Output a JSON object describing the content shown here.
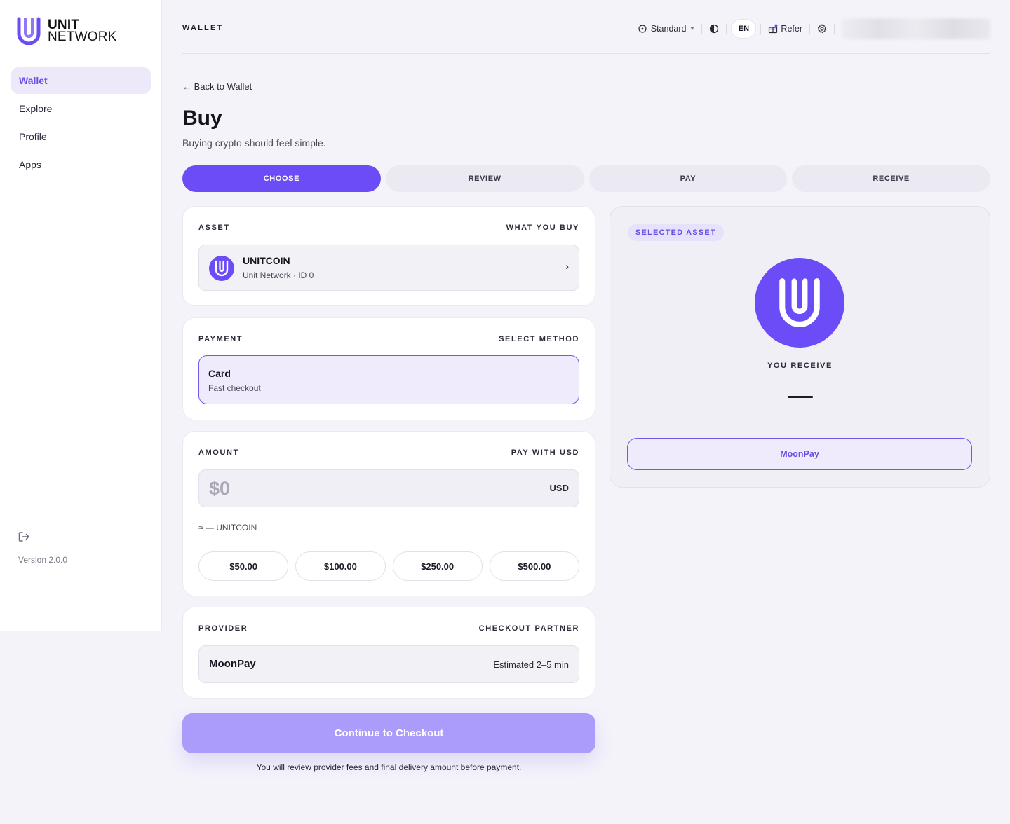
{
  "brand": {
    "line1": "UNIT",
    "line2": "NETWORK",
    "accent": "#6b4cf6"
  },
  "sidebar": {
    "items": [
      {
        "label": "Wallet",
        "active": true
      },
      {
        "label": "Explore"
      },
      {
        "label": "Profile"
      },
      {
        "label": "Apps"
      }
    ],
    "version": "Version 2.0.0",
    "logout_icon": "logout-icon"
  },
  "header": {
    "title": "WALLET",
    "mode": "Standard",
    "language": "EN",
    "refer": "Refer"
  },
  "page": {
    "back": "← Back to Wallet",
    "title": "Buy",
    "subtitle": "Buying crypto should feel simple."
  },
  "steps": [
    "CHOOSE",
    "REVIEW",
    "PAY",
    "RECEIVE"
  ],
  "asset": {
    "heading": "ASSET",
    "heading_right": "WHAT YOU BUY",
    "name": "UNITCOIN",
    "sub": "Unit Network · ID 0"
  },
  "payment": {
    "heading": "PAYMENT",
    "heading_right": "SELECT METHOD",
    "method": "Card",
    "method_sub": "Fast checkout"
  },
  "amount": {
    "heading": "AMOUNT",
    "heading_right": "PAY WITH USD",
    "placeholder": "$0",
    "currency": "USD",
    "approx": "≈ — UNITCOIN",
    "presets": [
      "$50.00",
      "$100.00",
      "$250.00",
      "$500.00"
    ]
  },
  "provider": {
    "heading": "PROVIDER",
    "heading_right": "CHECKOUT PARTNER",
    "name": "MoonPay",
    "estimate": "Estimated 2–5 min"
  },
  "cta": {
    "label": "Continue to Checkout",
    "note": "You will review provider fees and final delivery amount before payment."
  },
  "summary": {
    "badge": "SELECTED ASSET",
    "receive_label": "YOU RECEIVE",
    "provider_button": "MoonPay"
  }
}
